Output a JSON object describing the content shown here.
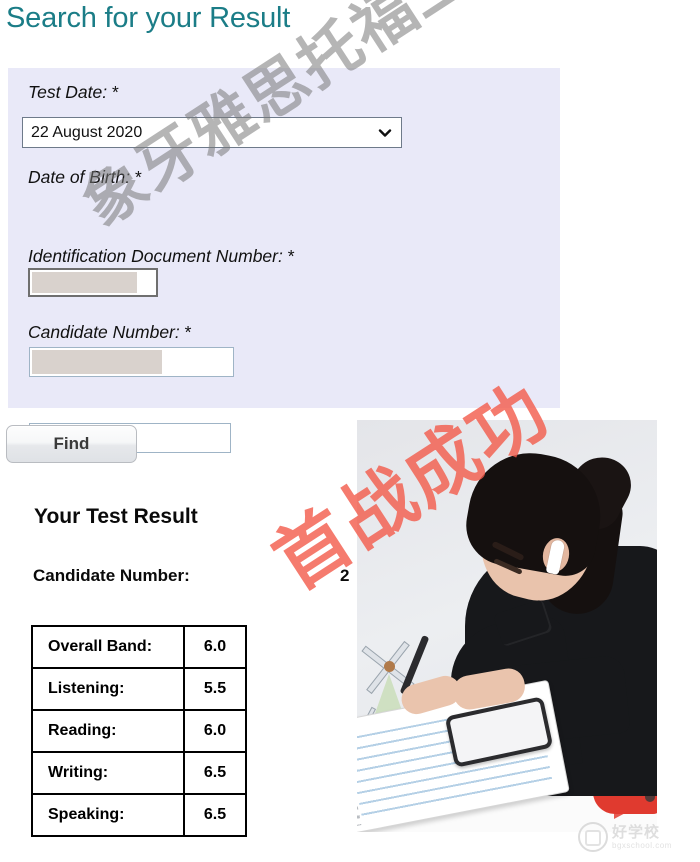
{
  "page": {
    "title": "Search for your Result"
  },
  "form": {
    "test_date": {
      "label": "Test Date:",
      "required_marker": "*",
      "selected_value": "22 August 2020",
      "options": [
        "22 August 2020"
      ],
      "chevron_icon": "chevron-down-icon"
    },
    "date_of_birth": {
      "label": "Date of Birth:",
      "required_marker": "*",
      "value": "",
      "redacted": true
    },
    "identification_document_number": {
      "label": "Identification Document Number:",
      "required_marker": "*",
      "value": "",
      "redacted": true
    },
    "candidate_number": {
      "label": "Candidate Number:",
      "required_marker": "*",
      "value": "",
      "redacted": true
    },
    "submit_label": "Find"
  },
  "result": {
    "heading": "Your Test Result",
    "candidate_number_label": "Candidate Number:",
    "candidate_number_value": "2",
    "scores": [
      {
        "label": "Overall Band:",
        "value": "6.0"
      },
      {
        "label": "Listening:",
        "value": "5.5"
      },
      {
        "label": "Reading:",
        "value": "6.0"
      },
      {
        "label": "Writing:",
        "value": "6.5"
      },
      {
        "label": "Speaking:",
        "value": "6.5"
      }
    ]
  },
  "watermarks": {
    "gray_text": "象牙雅思托福工作室",
    "gray_color": "#787878",
    "red_text": "首战成功",
    "red_color": "#f25a4a"
  },
  "site_logo": {
    "name_cn": "好学校",
    "name_en": "bgxschool.com"
  },
  "photo": {
    "alt": "Student writing notes at a desk wearing earbuds"
  },
  "colors": {
    "title": "#1b7d87",
    "panel_background": "#e9e9f8",
    "redaction": "#d9d2cd",
    "table_border": "#000000"
  }
}
